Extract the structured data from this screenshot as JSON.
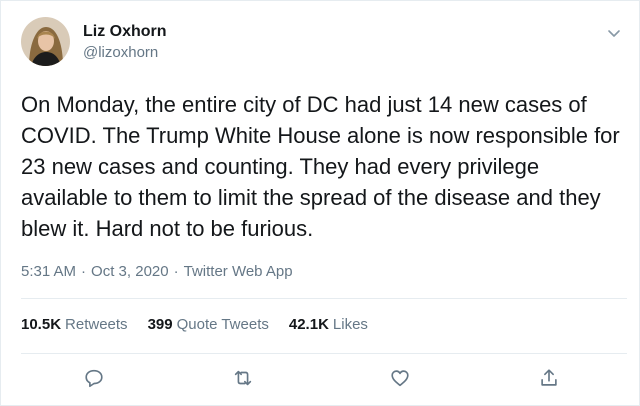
{
  "user": {
    "display_name": "Liz Oxhorn",
    "handle": "@lizoxhorn",
    "avatar_icon": "profile-photo"
  },
  "tweet": {
    "text": "On Monday, the entire city of DC had just 14 new cases of COVID. The Trump White House alone is now responsible for 23 new cases and counting. They had every privilege available to them to limit the spread of the disease and they blew it. Hard not to be furious."
  },
  "meta": {
    "time": "5:31 AM",
    "separator": "·",
    "date": "Oct 3, 2020",
    "source": "Twitter Web App"
  },
  "stats": {
    "retweets": {
      "count": "10.5K",
      "label": "Retweets"
    },
    "quote_tweets": {
      "count": "399",
      "label": "Quote Tweets"
    },
    "likes": {
      "count": "42.1K",
      "label": "Likes"
    }
  },
  "actions": [
    "reply-icon",
    "retweet-icon",
    "like-icon",
    "share-icon"
  ],
  "colors": {
    "text": "#14171a",
    "secondary": "#657786",
    "border": "#e6ecf0",
    "icon": "#657786"
  }
}
